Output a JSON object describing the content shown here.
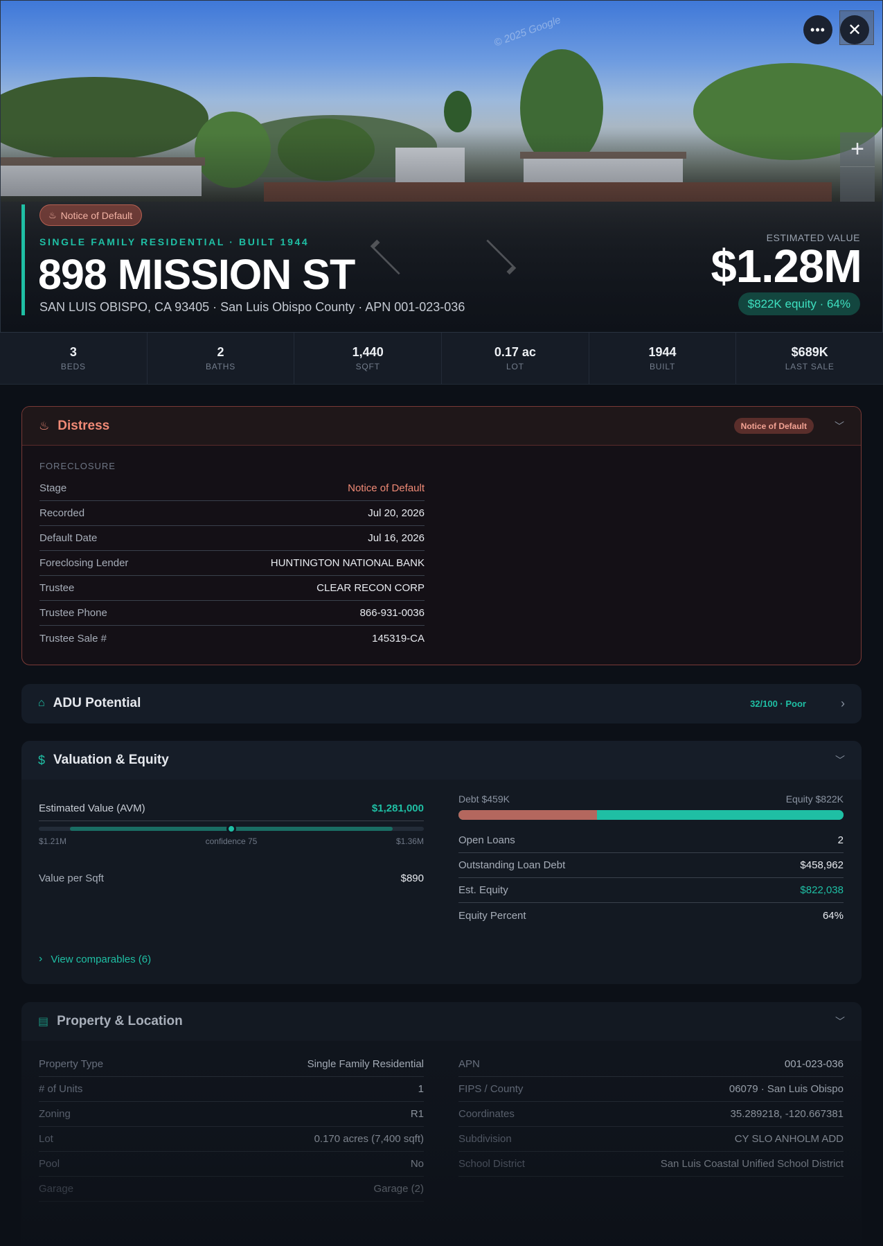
{
  "hero": {
    "watermark": "© 2025 Google",
    "status_chip": "Notice of Default",
    "kicker": "SINGLE FAMILY RESIDENTIAL · BUILT 1944",
    "address": "898 MISSION ST",
    "subaddress": "SAN LUIS OBISPO, CA 93405 · San Luis Obispo County · APN 001-023-036",
    "estimated_label": "ESTIMATED VALUE",
    "estimated_value": "$1.28M",
    "equity_chip": "$822K equity · 64%",
    "more_icon": "ellipsis-icon",
    "close_icon": "close-icon",
    "zoom_in_icon": "plus-icon"
  },
  "stats": [
    {
      "value": "3",
      "label": "BEDS"
    },
    {
      "value": "2",
      "label": "BATHS"
    },
    {
      "value": "1,440",
      "label": "SQFT"
    },
    {
      "value": "0.17 ac",
      "label": "LOT"
    },
    {
      "value": "1944",
      "label": "BUILT"
    },
    {
      "value": "$689K",
      "label": "LAST SALE"
    }
  ],
  "distress": {
    "title": "Distress",
    "badge": "Notice of Default",
    "section_label": "FORECLOSURE",
    "rows": [
      {
        "k": "Stage",
        "v": "Notice of Default"
      },
      {
        "k": "Recorded",
        "v": "Jul 20, 2026"
      },
      {
        "k": "Default Date",
        "v": "Jul 16, 2026"
      },
      {
        "k": "Foreclosing Lender",
        "v": "HUNTINGTON NATIONAL BANK"
      },
      {
        "k": "Trustee",
        "v": "CLEAR RECON CORP"
      },
      {
        "k": "Trustee Phone",
        "v": "866-931-0036"
      },
      {
        "k": "Trustee Sale #",
        "v": "145319-CA"
      }
    ]
  },
  "adu": {
    "title": "ADU Potential",
    "badge": "32/100 · Poor"
  },
  "valuation": {
    "title": "Valuation & Equity",
    "avm_label": "Estimated Value (AVM)",
    "avm_value": "$1,281,000",
    "range_low": "$1.21M",
    "range_mid": "confidence 75",
    "range_high": "$1.36M",
    "confidence": 75,
    "vps_label": "Value per Sqft",
    "vps_value": "$890",
    "debt_label": "Debt $459K",
    "equity_label": "Equity $822K",
    "debt_share": 0.36,
    "rows": [
      {
        "k": "Open Loans",
        "v": "2"
      },
      {
        "k": "Outstanding Loan Debt",
        "v": "$458,962"
      },
      {
        "k": "Est. Equity",
        "v": "$822,038"
      },
      {
        "k": "Equity Percent",
        "v": "64%"
      }
    ],
    "comps_link": "View comparables (6)"
  },
  "property": {
    "title": "Property & Location",
    "left": [
      {
        "k": "Property Type",
        "v": "Single Family Residential"
      },
      {
        "k": "# of Units",
        "v": "1"
      },
      {
        "k": "Zoning",
        "v": "R1"
      },
      {
        "k": "Lot",
        "v": "0.170 acres (7,400 sqft)"
      },
      {
        "k": "Pool",
        "v": "No"
      },
      {
        "k": "Garage",
        "v": "Garage (2)"
      }
    ],
    "right": [
      {
        "k": "APN",
        "v": "001-023-036"
      },
      {
        "k": "FIPS / County",
        "v": "06079 · San Luis Obispo"
      },
      {
        "k": "Coordinates",
        "v": "35.289218, -120.667381"
      },
      {
        "k": "Subdivision",
        "v": "CY SLO ANHOLM ADD"
      },
      {
        "k": "School District",
        "v": "San Luis Coastal Unified School District"
      }
    ]
  },
  "colors": {
    "accent": "#1fbfa4",
    "distress": "#f08a76",
    "debt": "#b4675e"
  }
}
